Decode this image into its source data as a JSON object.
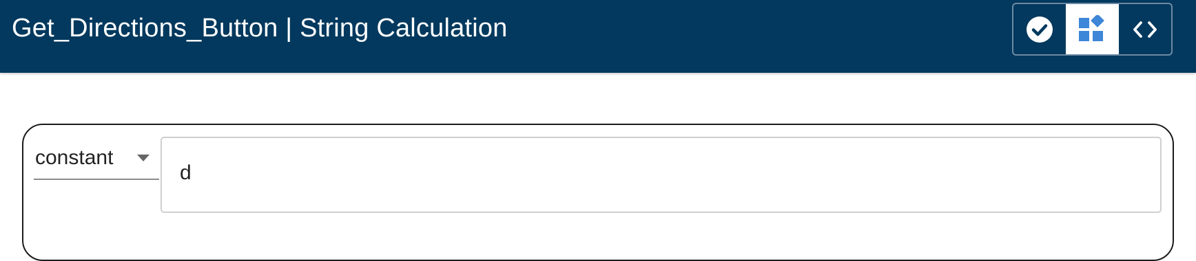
{
  "header": {
    "title": "Get_Directions_Button | String Calculation",
    "modes": [
      {
        "icon": "check-circle-icon",
        "active": false
      },
      {
        "icon": "widgets-icon",
        "active": true
      },
      {
        "icon": "code-icon",
        "active": false
      }
    ]
  },
  "editor": {
    "source_type": "constant",
    "value": "d"
  },
  "colors": {
    "header_bg": "#03395e",
    "accent": "#3e86d8"
  }
}
